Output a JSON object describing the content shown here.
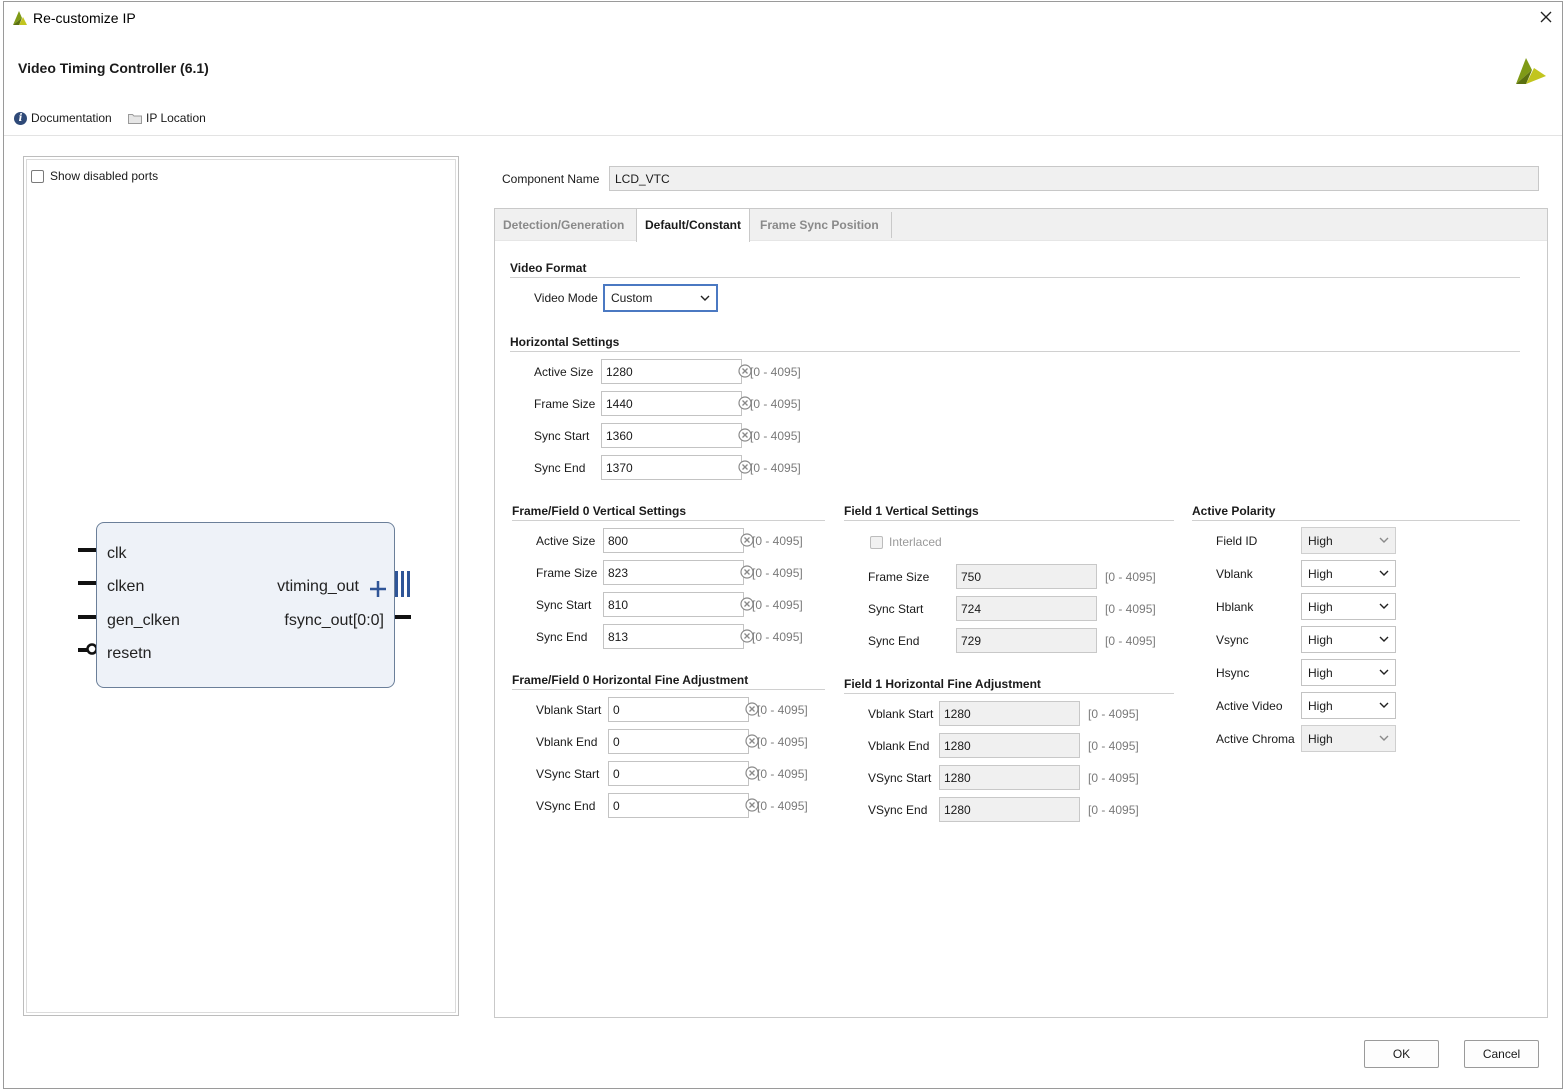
{
  "window": {
    "title": "Re-customize IP",
    "close_icon": "close-icon"
  },
  "header": {
    "ip_title": "Video Timing Controller (6.1)",
    "documentation": "Documentation",
    "ip_location": "IP Location"
  },
  "left_panel": {
    "show_disabled_ports": "Show disabled ports",
    "ports_left": [
      "clk",
      "clken",
      "gen_clken",
      "resetn"
    ],
    "ports_right": [
      "vtiming_out",
      "fsync_out[0:0]"
    ]
  },
  "component": {
    "label": "Component Name",
    "value": "LCD_VTC"
  },
  "tabs": [
    "Detection/Generation",
    "Default/Constant",
    "Frame Sync Position"
  ],
  "active_tab": "Default/Constant",
  "video_format": {
    "title": "Video Format",
    "mode_label": "Video Mode",
    "mode_value": "Custom"
  },
  "horizontal": {
    "title": "Horizontal Settings",
    "rows": [
      {
        "label": "Active Size",
        "value": "1280",
        "range": "[0 - 4095]"
      },
      {
        "label": "Frame Size",
        "value": "1440",
        "range": "[0 - 4095]"
      },
      {
        "label": "Sync Start",
        "value": "1360",
        "range": "[0 - 4095]"
      },
      {
        "label": "Sync End",
        "value": "1370",
        "range": "[0 - 4095]"
      }
    ]
  },
  "f0_vertical": {
    "title": "Frame/Field 0 Vertical Settings",
    "rows": [
      {
        "label": "Active Size",
        "value": "800",
        "range": "[0 - 4095]"
      },
      {
        "label": "Frame Size",
        "value": "823",
        "range": "[0 - 4095]"
      },
      {
        "label": "Sync Start",
        "value": "810",
        "range": "[0 - 4095]"
      },
      {
        "label": "Sync End",
        "value": "813",
        "range": "[0 - 4095]"
      }
    ]
  },
  "f1_vertical": {
    "title": "Field 1 Vertical Settings",
    "interlaced": "Interlaced",
    "rows": [
      {
        "label": "Frame Size",
        "value": "750",
        "range": "[0 - 4095]"
      },
      {
        "label": "Sync Start",
        "value": "724",
        "range": "[0 - 4095]"
      },
      {
        "label": "Sync End",
        "value": "729",
        "range": "[0 - 4095]"
      }
    ]
  },
  "f0_hfine": {
    "title": "Frame/Field 0 Horizontal Fine Adjustment",
    "rows": [
      {
        "label": "Vblank Start",
        "value": "0",
        "range": "[0 - 4095]"
      },
      {
        "label": "Vblank End",
        "value": "0",
        "range": "[0 - 4095]"
      },
      {
        "label": "VSync Start",
        "value": "0",
        "range": "[0 - 4095]"
      },
      {
        "label": "VSync End",
        "value": "0",
        "range": "[0 - 4095]"
      }
    ]
  },
  "f1_hfine": {
    "title": "Field 1 Horizontal Fine Adjustment",
    "rows": [
      {
        "label": "Vblank Start",
        "value": "1280",
        "range": "[0 - 4095]"
      },
      {
        "label": "Vblank End",
        "value": "1280",
        "range": "[0 - 4095]"
      },
      {
        "label": "VSync Start",
        "value": "1280",
        "range": "[0 - 4095]"
      },
      {
        "label": "VSync End",
        "value": "1280",
        "range": "[0 - 4095]"
      }
    ]
  },
  "polarity": {
    "title": "Active Polarity",
    "rows": [
      {
        "label": "Field ID",
        "value": "High",
        "enabled": false
      },
      {
        "label": "Vblank",
        "value": "High",
        "enabled": true
      },
      {
        "label": "Hblank",
        "value": "High",
        "enabled": true
      },
      {
        "label": "Vsync",
        "value": "High",
        "enabled": true
      },
      {
        "label": "Hsync",
        "value": "High",
        "enabled": true
      },
      {
        "label": "Active Video",
        "value": "High",
        "enabled": true
      },
      {
        "label": "Active Chroma",
        "value": "High",
        "enabled": false
      }
    ]
  },
  "buttons": {
    "ok": "OK",
    "cancel": "Cancel"
  },
  "colors": {
    "accent": "#4b79c2",
    "block_fill": "#eef2f8",
    "block_border": "#6b7f99",
    "bus_port": "#2f5597"
  }
}
